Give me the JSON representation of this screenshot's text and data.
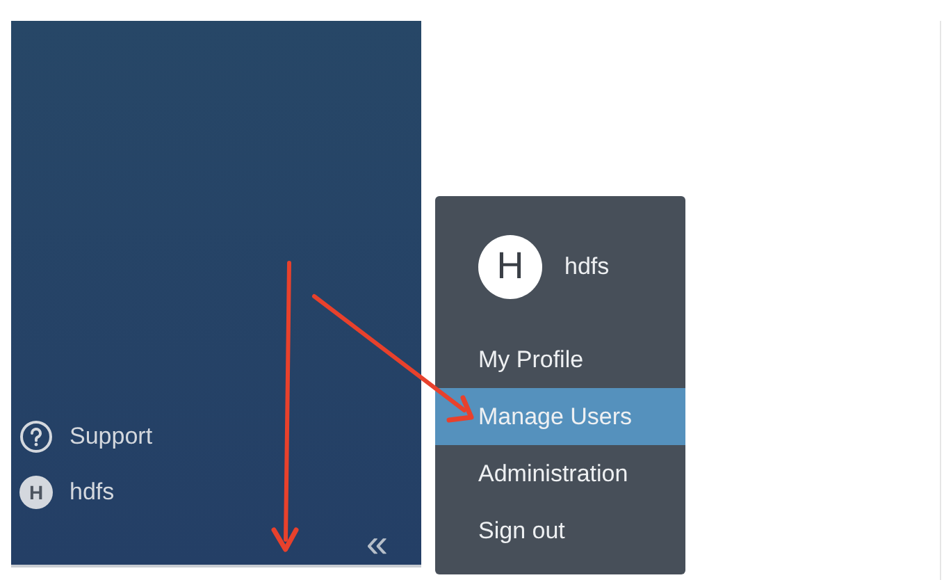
{
  "sidebar": {
    "items": [
      {
        "kind": "help",
        "label": "Support"
      },
      {
        "kind": "user",
        "label": "hdfs",
        "avatar": "H"
      }
    ],
    "collapse": "«"
  },
  "user_menu": {
    "avatar": "H",
    "username": "hdfs",
    "items": [
      {
        "label": "My Profile",
        "selected": false
      },
      {
        "label": "Manage Users",
        "selected": true
      },
      {
        "label": "Administration",
        "selected": false
      },
      {
        "label": "Sign out",
        "selected": false
      }
    ]
  }
}
